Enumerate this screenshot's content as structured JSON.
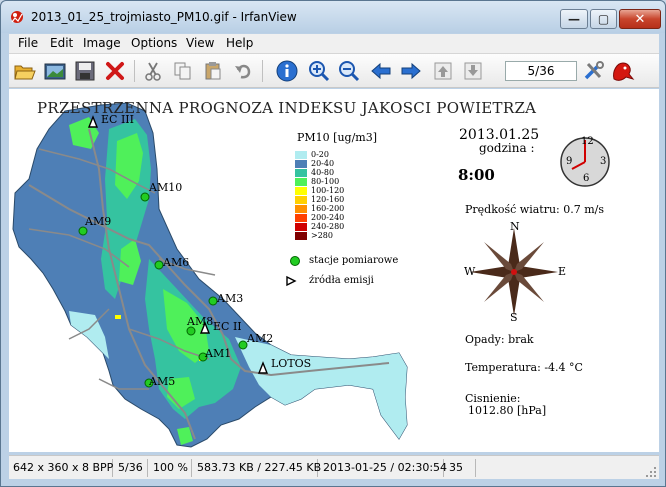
{
  "window": {
    "title": "2013_01_25_trojmiasto_PM10.gif - IrfanView",
    "minimize_glyph": "—",
    "maximize_glyph": "▢",
    "close_glyph": "✕"
  },
  "menu": {
    "items": [
      "File",
      "Edit",
      "Image",
      "Options",
      "View",
      "Help"
    ]
  },
  "toolbar": {
    "page_counter": "5/36",
    "icons": [
      "open-icon",
      "thumbnails-icon",
      "save-icon",
      "delete-icon",
      "cut-icon",
      "copy-icon",
      "paste-icon",
      "undo-icon",
      "info-icon",
      "zoom-in-icon",
      "zoom-out-icon",
      "previous-icon",
      "next-icon",
      "first-page-icon",
      "last-page-icon",
      "settings-icon",
      "irfanview-logo-icon"
    ]
  },
  "map": {
    "title": "PRZESTRZENNA PROGNOZA INDEKSU JAKOSCI POWIETRZA",
    "legend_title": "PM10  [ug/m3]",
    "legend": [
      {
        "label": "0-20",
        "color": "#b0ecf0"
      },
      {
        "label": "20-40",
        "color": "#4e7fb6"
      },
      {
        "label": "40-80",
        "color": "#35c3a0"
      },
      {
        "label": "80-100",
        "color": "#4ff05a"
      },
      {
        "label": "100-120",
        "color": "#ffff00"
      },
      {
        "label": "120-160",
        "color": "#ffd000"
      },
      {
        "label": "160-200",
        "color": "#ff9000"
      },
      {
        "label": "200-240",
        "color": "#ff4000"
      },
      {
        "label": "240-280",
        "color": "#d00000"
      },
      {
        "label": ">280",
        "color": "#800000"
      }
    ],
    "legend_stations": "stacje pomiarowe",
    "legend_sources": "źródła emisji",
    "date": "2013.01.25",
    "hour_label": "godzina :",
    "hour_value": "8:00",
    "clock_numbers": [
      "12",
      "3",
      "6",
      "9"
    ],
    "wind": "Prędkość wiatru: 0.7 m/s",
    "compass": {
      "n": "N",
      "s": "S",
      "e": "E",
      "w": "W"
    },
    "precipitation": "Opady: brak",
    "temperature": "Temperatura: -4.4 °C",
    "pressure_label": "Cisnienie:",
    "pressure_value": "1012.80 [hPa]",
    "stations": [
      "AM10",
      "AM9",
      "AM6",
      "AM3",
      "AM8",
      "AM2",
      "AM1",
      "AM5"
    ],
    "sources": [
      "EC III",
      "EC II",
      "LOTOS"
    ]
  },
  "status": {
    "dims": "642 x 360 x 8 BPP",
    "page": "5/36",
    "zoom": "100 %",
    "size": "583.73 KB / 227.45 KB",
    "datetime": "2013-01-25 / 02:30:54",
    "count": "35"
  }
}
